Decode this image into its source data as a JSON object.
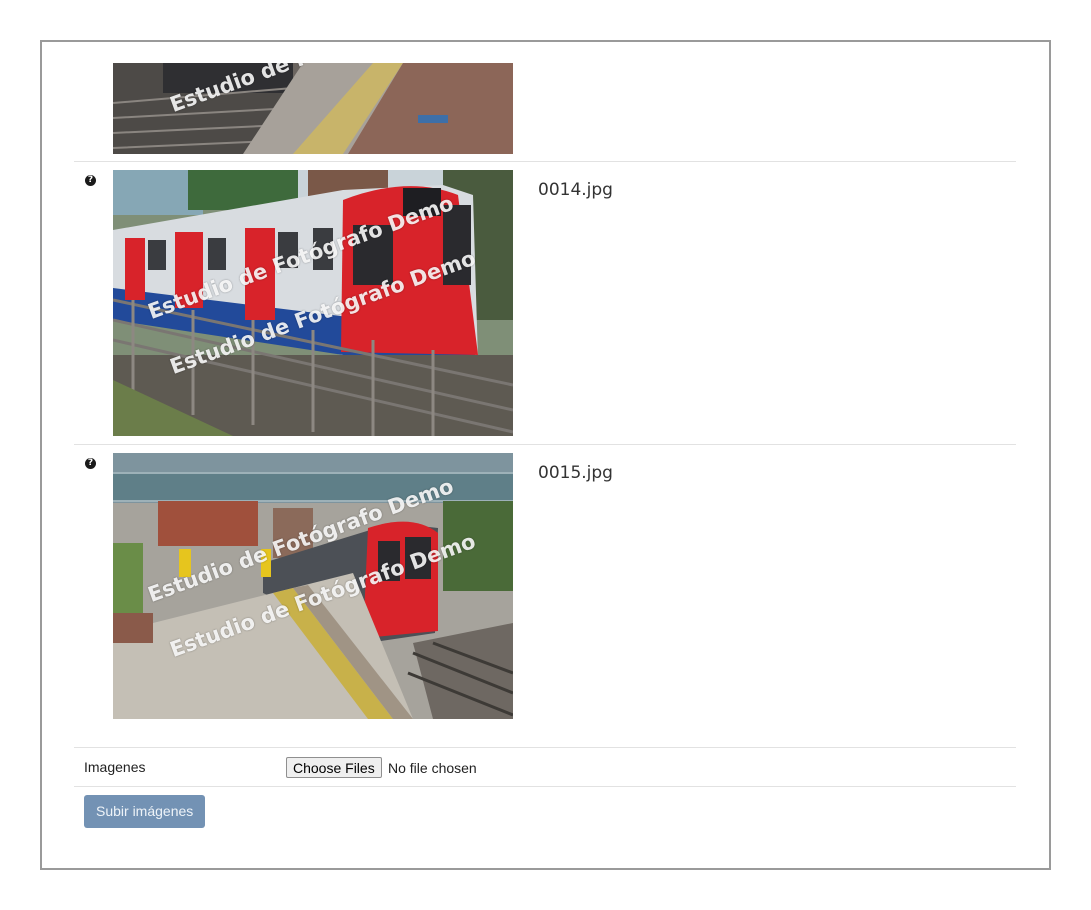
{
  "gallery": {
    "watermark": "Estudio de Fotógrafo Demo",
    "help_symbol": "?",
    "items": [
      {
        "filename": "",
        "watermark_partial": "Estudio de F"
      },
      {
        "filename": "0014.jpg"
      },
      {
        "filename": "0015.jpg"
      }
    ]
  },
  "upload": {
    "field_label": "Imagenes",
    "choose_button": "Choose Files",
    "file_status": "No file chosen",
    "submit_label": "Subir imágenes"
  },
  "colors": {
    "panel_border": "#9a9a9a",
    "submit_background": "#7392b4",
    "train_red": "#d8232a"
  },
  "icons": {
    "help": "help-icon",
    "train_photo_1": "platform-photo",
    "train_photo_2": "red-white-train-photo",
    "train_photo_3": "red-train-station-photo"
  }
}
